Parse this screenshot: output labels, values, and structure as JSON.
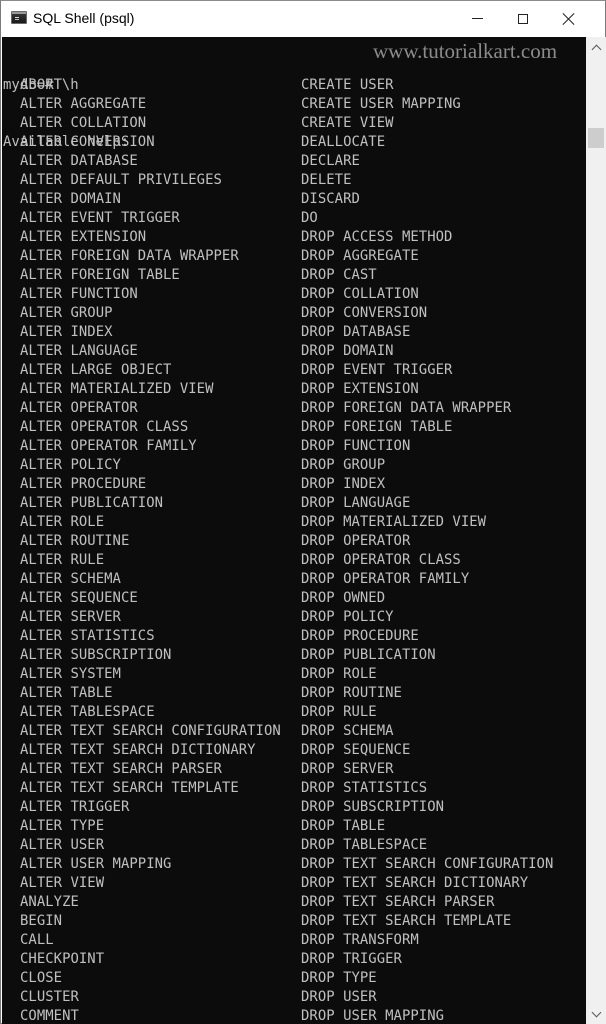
{
  "window": {
    "title": "SQL Shell (psql)",
    "icon": "terminal-icon",
    "controls": {
      "minimize": "minimize-icon",
      "maximize": "maximize-icon",
      "close": "close-icon"
    }
  },
  "terminal": {
    "prompt_line": "mydb=# \\h",
    "header_line": "Available help:",
    "watermark": "www.tutorialkart.com",
    "left_column": [
      "ABORT",
      "ALTER AGGREGATE",
      "ALTER COLLATION",
      "ALTER CONVERSION",
      "ALTER DATABASE",
      "ALTER DEFAULT PRIVILEGES",
      "ALTER DOMAIN",
      "ALTER EVENT TRIGGER",
      "ALTER EXTENSION",
      "ALTER FOREIGN DATA WRAPPER",
      "ALTER FOREIGN TABLE",
      "ALTER FUNCTION",
      "ALTER GROUP",
      "ALTER INDEX",
      "ALTER LANGUAGE",
      "ALTER LARGE OBJECT",
      "ALTER MATERIALIZED VIEW",
      "ALTER OPERATOR",
      "ALTER OPERATOR CLASS",
      "ALTER OPERATOR FAMILY",
      "ALTER POLICY",
      "ALTER PROCEDURE",
      "ALTER PUBLICATION",
      "ALTER ROLE",
      "ALTER ROUTINE",
      "ALTER RULE",
      "ALTER SCHEMA",
      "ALTER SEQUENCE",
      "ALTER SERVER",
      "ALTER STATISTICS",
      "ALTER SUBSCRIPTION",
      "ALTER SYSTEM",
      "ALTER TABLE",
      "ALTER TABLESPACE",
      "ALTER TEXT SEARCH CONFIGURATION",
      "ALTER TEXT SEARCH DICTIONARY",
      "ALTER TEXT SEARCH PARSER",
      "ALTER TEXT SEARCH TEMPLATE",
      "ALTER TRIGGER",
      "ALTER TYPE",
      "ALTER USER",
      "ALTER USER MAPPING",
      "ALTER VIEW",
      "ANALYZE",
      "BEGIN",
      "CALL",
      "CHECKPOINT",
      "CLOSE",
      "CLUSTER",
      "COMMENT"
    ],
    "right_column": [
      "CREATE USER",
      "CREATE USER MAPPING",
      "CREATE VIEW",
      "DEALLOCATE",
      "DECLARE",
      "DELETE",
      "DISCARD",
      "DO",
      "DROP ACCESS METHOD",
      "DROP AGGREGATE",
      "DROP CAST",
      "DROP COLLATION",
      "DROP CONVERSION",
      "DROP DATABASE",
      "DROP DOMAIN",
      "DROP EVENT TRIGGER",
      "DROP EXTENSION",
      "DROP FOREIGN DATA WRAPPER",
      "DROP FOREIGN TABLE",
      "DROP FUNCTION",
      "DROP GROUP",
      "DROP INDEX",
      "DROP LANGUAGE",
      "DROP MATERIALIZED VIEW",
      "DROP OPERATOR",
      "DROP OPERATOR CLASS",
      "DROP OPERATOR FAMILY",
      "DROP OWNED",
      "DROP POLICY",
      "DROP PROCEDURE",
      "DROP PUBLICATION",
      "DROP ROLE",
      "DROP ROUTINE",
      "DROP RULE",
      "DROP SCHEMA",
      "DROP SEQUENCE",
      "DROP SERVER",
      "DROP STATISTICS",
      "DROP SUBSCRIPTION",
      "DROP TABLE",
      "DROP TABLESPACE",
      "DROP TEXT SEARCH CONFIGURATION",
      "DROP TEXT SEARCH DICTIONARY",
      "DROP TEXT SEARCH PARSER",
      "DROP TEXT SEARCH TEMPLATE",
      "DROP TRANSFORM",
      "DROP TRIGGER",
      "DROP TYPE",
      "DROP USER",
      "DROP USER MAPPING"
    ]
  },
  "scrollbar": {
    "up_icon": "chevron-up-icon",
    "down_icon": "chevron-down-icon"
  },
  "colors": {
    "terminal_bg": "#0c0c0c",
    "terminal_fg": "#c0c0c0",
    "watermark": "#8c8c8c",
    "scrollbar_track": "#f0f0f0",
    "scrollbar_thumb": "#cdcdcd"
  }
}
